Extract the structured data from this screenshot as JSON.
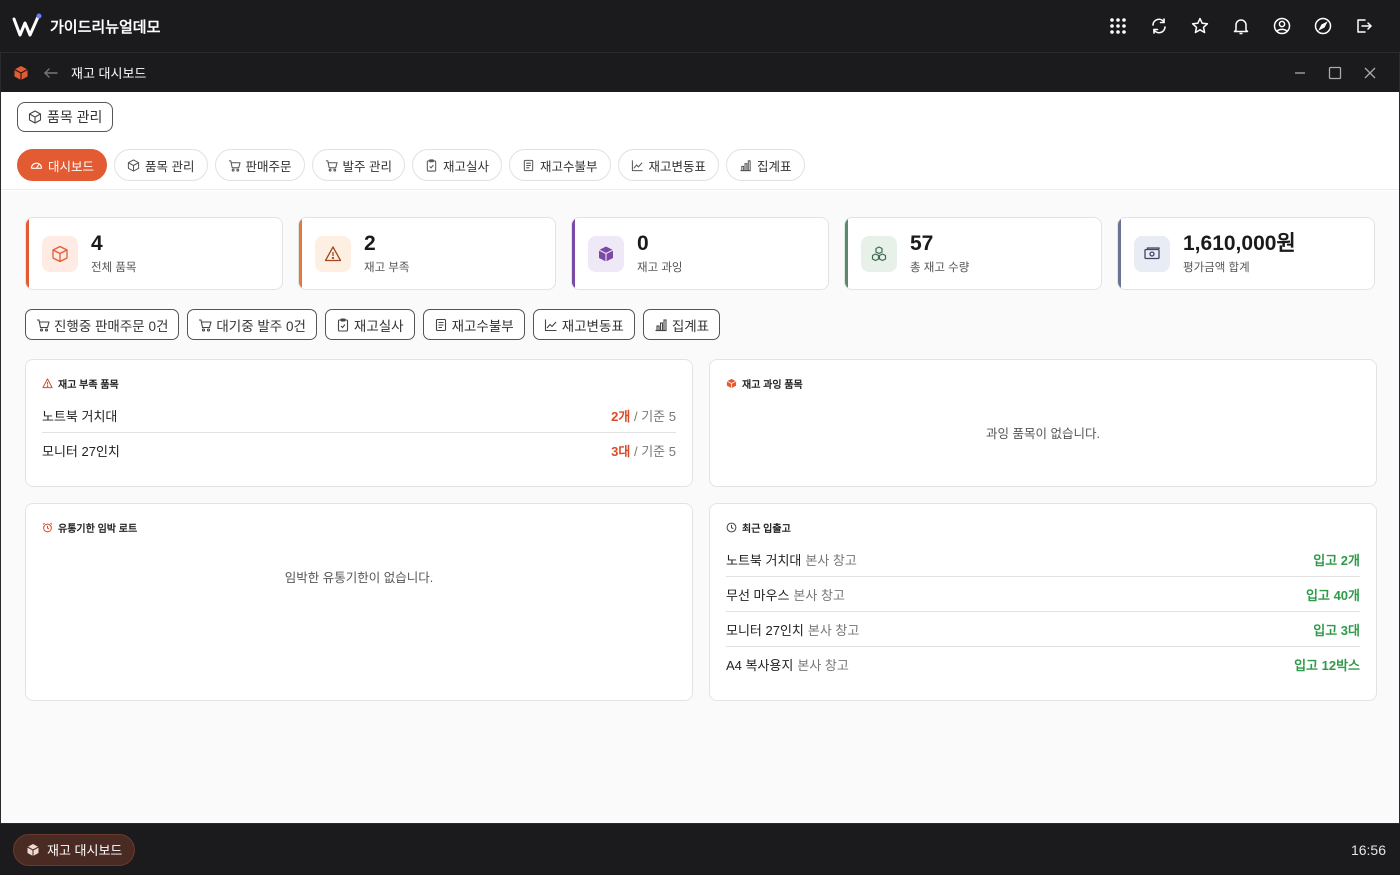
{
  "app": {
    "title": "가이드리뉴얼데모"
  },
  "top_icons": [
    "apps-grid-icon",
    "refresh-icon",
    "star-icon",
    "bell-icon",
    "user-icon",
    "compass-icon",
    "logout-icon"
  ],
  "window": {
    "title": "재고 대시보드"
  },
  "header": {
    "module_chip": "품목 관리"
  },
  "tabs": [
    {
      "label": "대시보드",
      "icon": "gauge-icon",
      "active": true
    },
    {
      "label": "품목 관리",
      "icon": "box-icon"
    },
    {
      "label": "판매주문",
      "icon": "cart-icon"
    },
    {
      "label": "발주 관리",
      "icon": "cart-icon"
    },
    {
      "label": "재고실사",
      "icon": "clipboard-icon"
    },
    {
      "label": "재고수불부",
      "icon": "ledger-icon"
    },
    {
      "label": "재고변동표",
      "icon": "line-chart-icon"
    },
    {
      "label": "집계표",
      "icon": "bar-chart-icon"
    }
  ],
  "stats": [
    {
      "value": "4",
      "label": "전체 품목",
      "color": "#e35b33",
      "bg": "#fdebe4"
    },
    {
      "value": "2",
      "label": "재고 부족",
      "color": "#e07a3a",
      "bg": "#fdf0e2"
    },
    {
      "value": "0",
      "label": "재고 과잉",
      "color": "#7b4aa6",
      "bg": "#efe8f6"
    },
    {
      "value": "57",
      "label": "총 재고 수량",
      "color": "#5a8a6a",
      "bg": "#e7f1ea"
    },
    {
      "value": "1,610,000원",
      "label": "평가금액 합계",
      "color": "#6a7490",
      "bg": "#e9ecf4"
    }
  ],
  "quick": [
    "진행중 판매주문 0건",
    "대기중 발주 0건",
    "재고실사",
    "재고수불부",
    "재고변동표",
    "집계표"
  ],
  "shortage": {
    "title": "재고 부족 품목",
    "rows": [
      {
        "name": "노트북 거치대",
        "qty": "2개",
        "base": "/ 기준 5"
      },
      {
        "name": "모니터 27인치",
        "qty": "3대",
        "base": "/ 기준 5"
      }
    ]
  },
  "excess": {
    "title": "재고 과잉 품목",
    "empty": "과잉 품목이 없습니다."
  },
  "expiry": {
    "title": "유통기한 임박 로트",
    "empty": "임박한 유통기한이 없습니다."
  },
  "recent": {
    "title": "최근 입출고",
    "rows": [
      {
        "name": "노트북 거치대",
        "wh": "본사 창고",
        "qty": "입고 2개"
      },
      {
        "name": "무선 마우스",
        "wh": "본사 창고",
        "qty": "입고 40개"
      },
      {
        "name": "모니터 27인치",
        "wh": "본사 창고",
        "qty": "입고 3대"
      },
      {
        "name": "A4 복사용지",
        "wh": "본사 창고",
        "qty": "입고 12박스"
      }
    ]
  },
  "taskbar": {
    "item": "재고 대시보드",
    "clock": "16:56"
  }
}
